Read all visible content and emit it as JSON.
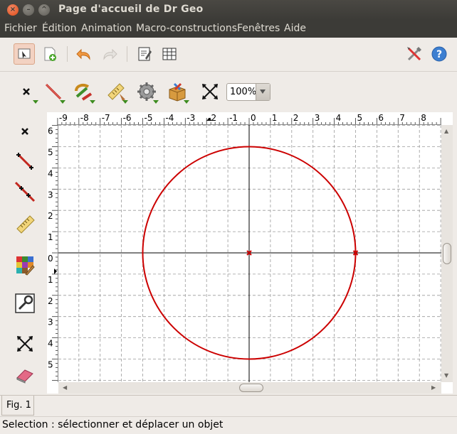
{
  "window": {
    "title": "Page d'accueil de Dr Geo"
  },
  "menu": [
    "Fichier",
    "Édition",
    "Animation",
    "Macro-constructions",
    "Fenêtres",
    "Aide"
  ],
  "toolbar": {
    "buttons": [
      "select-icon",
      "new-figure-icon",
      "undo-icon",
      "redo-icon",
      "script-editor-icon",
      "grid-icon",
      "preferences-icon",
      "help-icon"
    ]
  },
  "geometry_toolbar": {
    "tools": [
      "point-tools-icon",
      "line-tools-icon",
      "transformation-tools-icon",
      "numeric-tools-icon",
      "macro-tools-icon",
      "other-tools-icon",
      "move-icon"
    ],
    "zoom": "100%"
  },
  "palette": [
    "point-icon",
    "segment-icon",
    "line-icon",
    "ruler-icon",
    "color-style-icon",
    "properties-icon",
    "move-tool-icon",
    "eraser-icon"
  ],
  "axes": {
    "x_ticks": [
      "-9",
      "-8",
      "-7",
      "-6",
      "-5",
      "-4",
      "-3",
      "-2",
      "-1",
      "0",
      "1",
      "2",
      "3",
      "4",
      "5",
      "6",
      "7",
      "8"
    ],
    "y_ticks": [
      "6",
      "5",
      "4",
      "3",
      "2",
      "1",
      "0",
      "1",
      "2",
      "3",
      "4",
      "5"
    ]
  },
  "figure": {
    "circle": {
      "center": [
        0,
        0
      ],
      "radius": 5,
      "color": "#cc0000"
    },
    "points": [
      {
        "x": 0,
        "y": 0
      },
      {
        "x": 5,
        "y": 0
      }
    ]
  },
  "tabs": [
    "Fig. 1"
  ],
  "status": "Selection : sélectionner et déplacer un objet"
}
